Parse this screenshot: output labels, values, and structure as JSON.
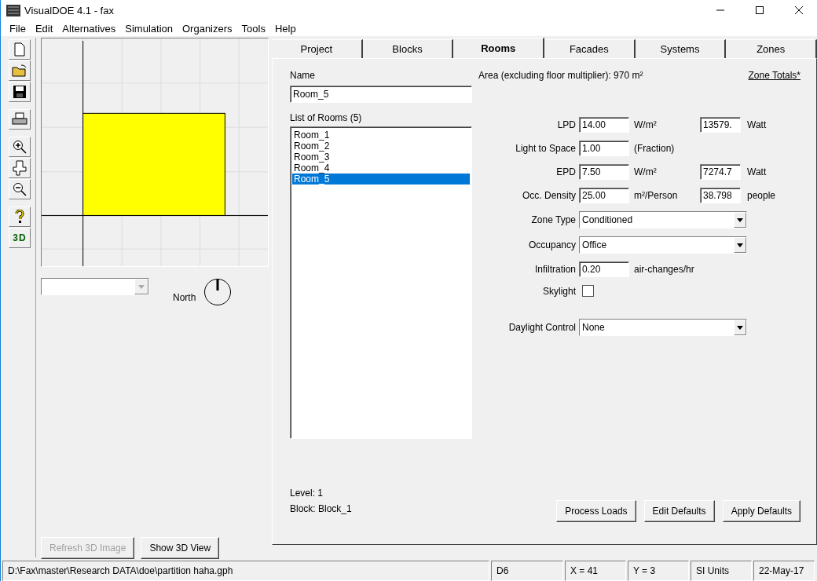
{
  "window": {
    "title": "VisualDOE 4.1 - fax"
  },
  "menu": [
    "File",
    "Edit",
    "Alternatives",
    "Simulation",
    "Organizers",
    "Tools",
    "Help"
  ],
  "toolbar": {
    "view_3d_label": "3D"
  },
  "plan": {
    "north_label": "North",
    "buttons": [
      {
        "label": "Refresh 3D Image",
        "disabled": true
      },
      {
        "label": "Show 3D View",
        "disabled": false
      }
    ]
  },
  "tabs": [
    {
      "label": "Project",
      "selected": false
    },
    {
      "label": "Blocks",
      "selected": false
    },
    {
      "label": "Rooms",
      "selected": true
    },
    {
      "label": "Facades",
      "selected": false
    },
    {
      "label": "Systems",
      "selected": false
    },
    {
      "label": "Zones",
      "selected": false
    }
  ],
  "rooms": {
    "name_label": "Name",
    "name_value": "Room_5",
    "area_text": "Area (excluding floor multiplier): 970 m²",
    "zone_totals_link": "Zone Totals*",
    "list_label": "List of Rooms (5)",
    "items": [
      {
        "label": "Room_1",
        "selected": false
      },
      {
        "label": "Room_2",
        "selected": false
      },
      {
        "label": "Room_3",
        "selected": false
      },
      {
        "label": "Room_4",
        "selected": false
      },
      {
        "label": "Room_5",
        "selected": true
      }
    ],
    "level": "Level: 1",
    "block": "Block: Block_1"
  },
  "fields": [
    {
      "kind": "number",
      "label": "LPD",
      "value": "14.00",
      "unit": "W/m²",
      "total": "13579.",
      "total_unit": "Watt"
    },
    {
      "kind": "number",
      "label": "Light to Space",
      "value": "1.00",
      "unit": "(Fraction)"
    },
    {
      "kind": "number",
      "label": "EPD",
      "value": "7.50",
      "unit": "W/m²",
      "total": "7274.7",
      "total_unit": "Watt"
    },
    {
      "kind": "number",
      "label": "Occ. Density",
      "value": "25.00",
      "unit": "m²/Person",
      "total": "38.798",
      "total_unit": "people"
    },
    {
      "kind": "select",
      "label": "Zone Type",
      "value": "Conditioned"
    },
    {
      "kind": "select",
      "label": "Occupancy",
      "value": "Office"
    },
    {
      "kind": "number",
      "label": "Infiltration",
      "value": "0.20",
      "unit": "air-changes/hr"
    },
    {
      "kind": "checkbox",
      "label": "Skylight",
      "checked": false
    },
    {
      "kind": "select",
      "label": "Daylight Control",
      "value": "None"
    }
  ],
  "actions": [
    "Process Loads",
    "Edit Defaults",
    "Apply Defaults"
  ],
  "status_bar": [
    "D:\\Fax\\master\\Research DATA\\doe\\partition haha.gph",
    "D6",
    "X = 41",
    "Y = 3",
    "SI Units",
    "22-May-17"
  ]
}
